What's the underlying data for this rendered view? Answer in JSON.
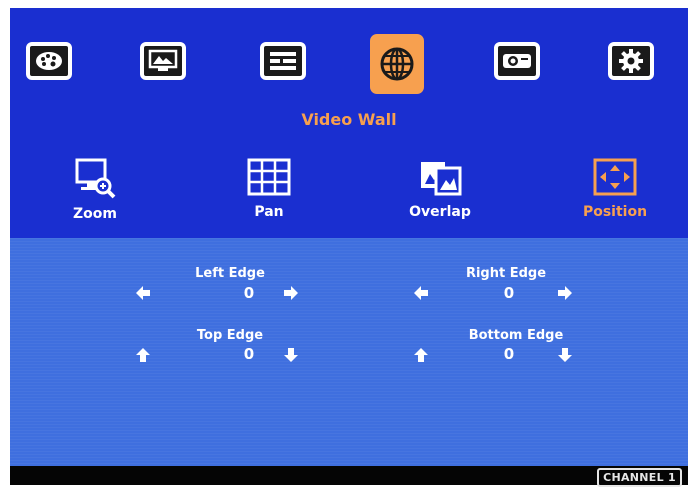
{
  "menu": {
    "items": [
      {
        "icon": "palette-icon"
      },
      {
        "icon": "picture-icon"
      },
      {
        "icon": "layout-icon"
      },
      {
        "icon": "globe-icon"
      },
      {
        "icon": "projector-icon"
      },
      {
        "icon": "gear-icon"
      }
    ],
    "active_index": 3,
    "section_title": "Video Wall"
  },
  "submenu": {
    "items": [
      {
        "label": "Zoom",
        "icon": "zoom-icon"
      },
      {
        "label": "Pan",
        "icon": "pan-grid-icon"
      },
      {
        "label": "Overlap",
        "icon": "overlap-icon"
      },
      {
        "label": "Position",
        "icon": "position-icon"
      }
    ],
    "active_label": "Position"
  },
  "params": {
    "left_edge": {
      "label": "Left Edge",
      "value": "0"
    },
    "right_edge": {
      "label": "Right Edge",
      "value": "0"
    },
    "top_edge": {
      "label": "Top Edge",
      "value": "0"
    },
    "bottom_edge": {
      "label": "Bottom Edge",
      "value": "0"
    }
  },
  "status": {
    "channel": "CHANNEL 1"
  },
  "colors": {
    "top_panel": "#1a2fd0",
    "bottom_panel": "#3f6fdf",
    "accent": "#f7a04f",
    "text": "#ffffff"
  }
}
